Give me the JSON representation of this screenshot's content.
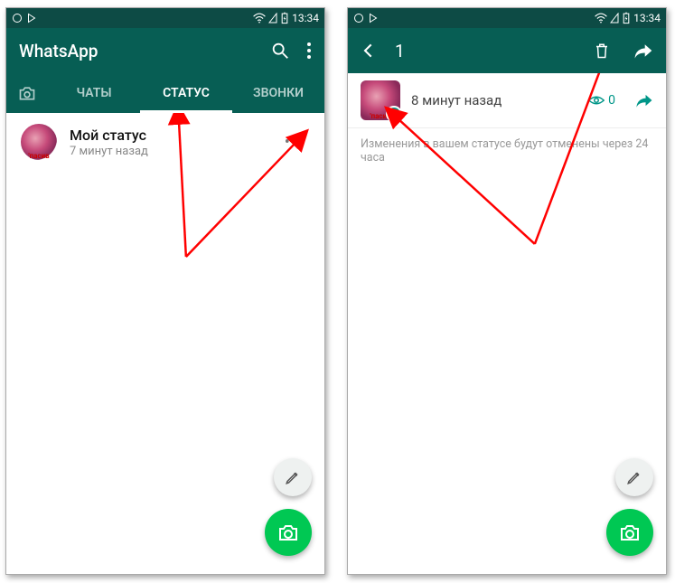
{
  "statusbar": {
    "time": "13:34"
  },
  "left": {
    "appTitle": "WhatsApp",
    "tabs": {
      "chats": "ЧАТЫ",
      "status": "СТАТУС",
      "calls": "ЗВОНКИ"
    },
    "status": {
      "title": "Мой статус",
      "subtitle": "7 минут назад",
      "more": "•••",
      "avatarLabel": "'пасив"
    }
  },
  "right": {
    "selectedCount": "1",
    "time": "8 минут назад",
    "viewsCount": "0",
    "note": "Изменения в вашем статусе будут отменены через 24 часа",
    "avatarLabel": "'пасив"
  },
  "colors": {
    "primary": "#075e54",
    "primaryDark": "#0d4b45",
    "accent": "#009688",
    "fabGreen": "#00c853",
    "arrowRed": "#ff0000"
  }
}
